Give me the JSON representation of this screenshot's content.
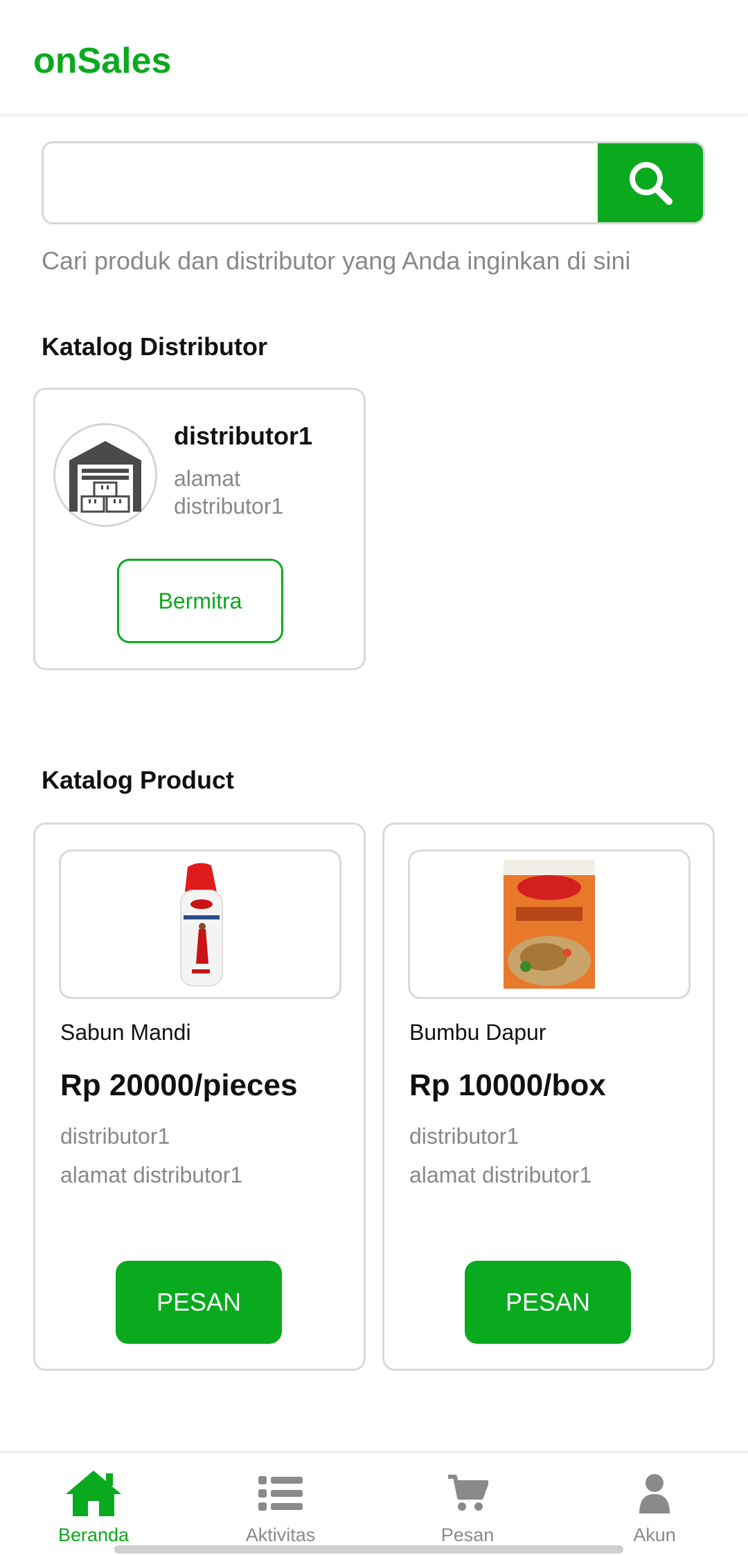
{
  "header": {
    "brand": "onSales"
  },
  "search": {
    "placeholder": "",
    "hint": "Cari produk dan distributor yang Anda inginkan di sini"
  },
  "distributor_section": {
    "title": "Katalog Distributor",
    "items": [
      {
        "name": "distributor1",
        "address": "alamat distributor1",
        "button_label": "Bermitra"
      }
    ]
  },
  "product_section": {
    "title": "Katalog Product",
    "items": [
      {
        "name": "Sabun Mandi",
        "price": "Rp 20000/pieces",
        "distributor": "distributor1",
        "address": "alamat distributor1",
        "button_label": "PESAN",
        "image": "body-wash-bottle"
      },
      {
        "name": "Bumbu Dapur",
        "price": "Rp 10000/box",
        "distributor": "distributor1",
        "address": "alamat distributor1",
        "button_label": "PESAN",
        "image": "seasoning-packet"
      }
    ]
  },
  "bottom_nav": {
    "items": [
      {
        "label": "Beranda",
        "icon": "home-icon",
        "active": true
      },
      {
        "label": "Aktivitas",
        "icon": "list-icon",
        "active": false
      },
      {
        "label": "Pesan",
        "icon": "cart-icon",
        "active": false
      },
      {
        "label": "Akun",
        "icon": "user-icon",
        "active": false
      }
    ]
  },
  "colors": {
    "accent": "#0aaa1e",
    "muted_text": "#888888",
    "border": "#d9d9d9"
  }
}
